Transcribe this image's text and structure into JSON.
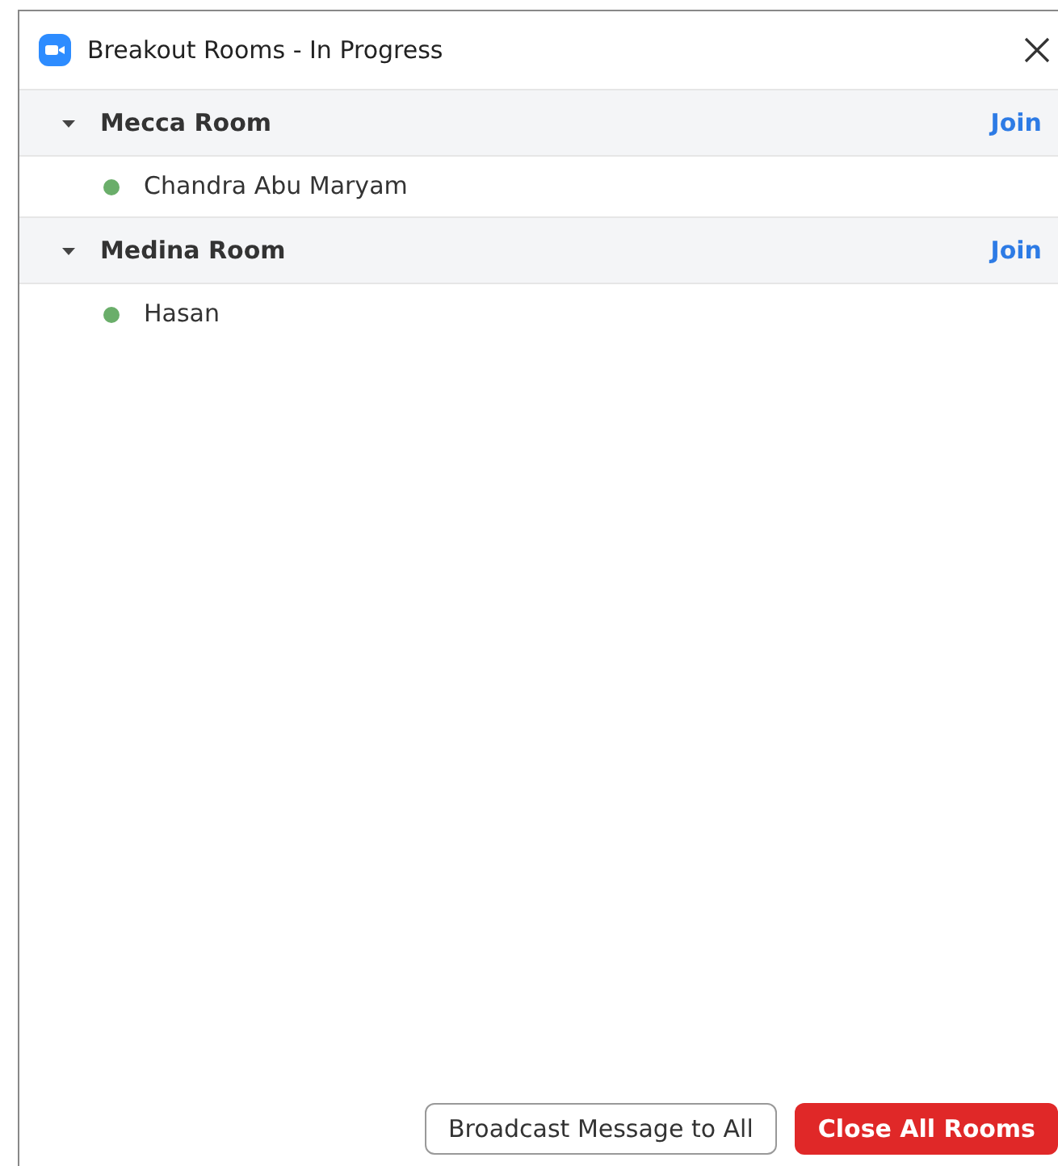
{
  "window": {
    "title": "Breakout Rooms - In Progress"
  },
  "rooms": [
    {
      "name": "Mecca Room",
      "expanded": true,
      "action": "Join",
      "participants": [
        {
          "name": "Chandra Abu Maryam",
          "color": "#6aae6a"
        }
      ]
    },
    {
      "name": "Medina Room",
      "expanded": true,
      "action": "Join",
      "participants": [
        {
          "name": "Hasan",
          "color": "#6aae6a"
        }
      ]
    }
  ],
  "buttons": [
    {
      "label": "Broadcast Message to All",
      "kind": "secondary"
    },
    {
      "label": "Close All Rooms",
      "kind": "danger"
    }
  ]
}
